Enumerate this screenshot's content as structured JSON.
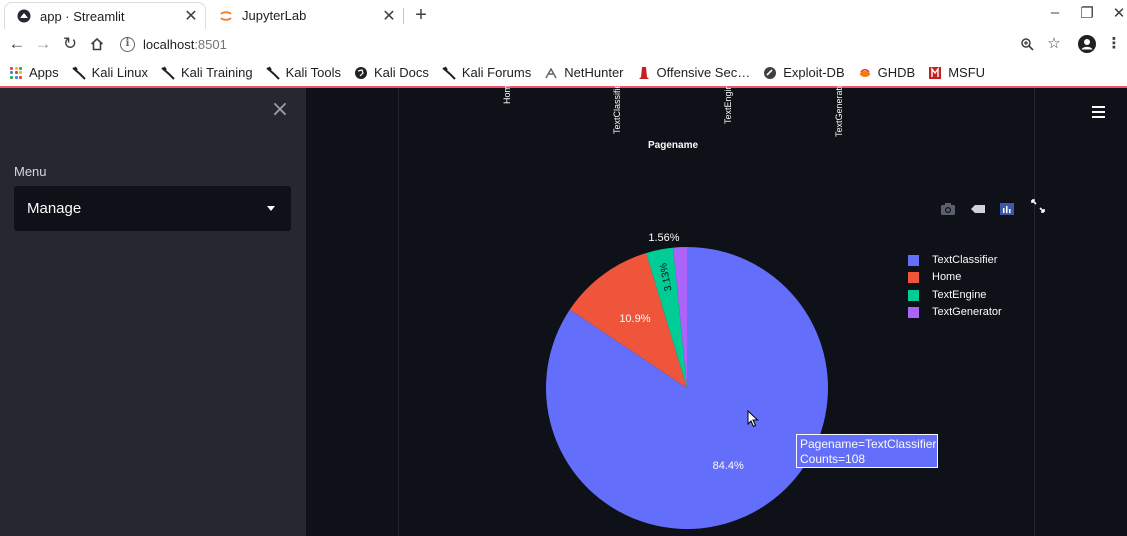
{
  "browser": {
    "tabs": [
      {
        "title": "app · Streamlit",
        "active": true
      },
      {
        "title": "JupyterLab",
        "active": false
      }
    ],
    "url_host": "localhost",
    "url_port": ":8501",
    "bookmarks": [
      {
        "label": "Apps",
        "icon": "apps-grid-icon"
      },
      {
        "label": "Kali Linux",
        "icon": "kali-dragon-icon"
      },
      {
        "label": "Kali Training",
        "icon": "kali-dragon-icon"
      },
      {
        "label": "Kali Tools",
        "icon": "kali-dragon-icon"
      },
      {
        "label": "Kali Docs",
        "icon": "globe-icon"
      },
      {
        "label": "Kali Forums",
        "icon": "kali-dragon-icon"
      },
      {
        "label": "NetHunter",
        "icon": "nethunter-icon"
      },
      {
        "label": "Offensive Sec…",
        "icon": "offsec-icon"
      },
      {
        "label": "Exploit-DB",
        "icon": "exploitdb-icon"
      },
      {
        "label": "GHDB",
        "icon": "ghdb-icon"
      },
      {
        "label": "MSFU",
        "icon": "msfu-icon"
      }
    ]
  },
  "sidebar": {
    "menu_label": "Menu",
    "selected": "Manage"
  },
  "bar_axis": {
    "tick_labels": [
      "Home",
      "TextClassifier",
      "TextEngine",
      "TextGenerator"
    ],
    "title": "Pagename"
  },
  "chart_data": {
    "type": "pie",
    "slices": [
      {
        "label": "TextClassifier",
        "value": 108,
        "percent": "84.4%",
        "color": "#636efa"
      },
      {
        "label": "Home",
        "value": 14,
        "percent": "10.9%",
        "color": "#ef553b"
      },
      {
        "label": "TextEngine",
        "value": 4,
        "percent": "3.13%",
        "color": "#00cc96"
      },
      {
        "label": "TextGenerator",
        "value": 2,
        "percent": "1.56%",
        "color": "#ab63fa"
      }
    ],
    "legend_position": "top-right",
    "hover": {
      "line1": "Pagename=TextClassifier",
      "line2": "Counts=108"
    }
  },
  "colors": {
    "app_bg": "#0e1117",
    "sidebar_bg": "#262730",
    "accent": "#f0556b"
  }
}
